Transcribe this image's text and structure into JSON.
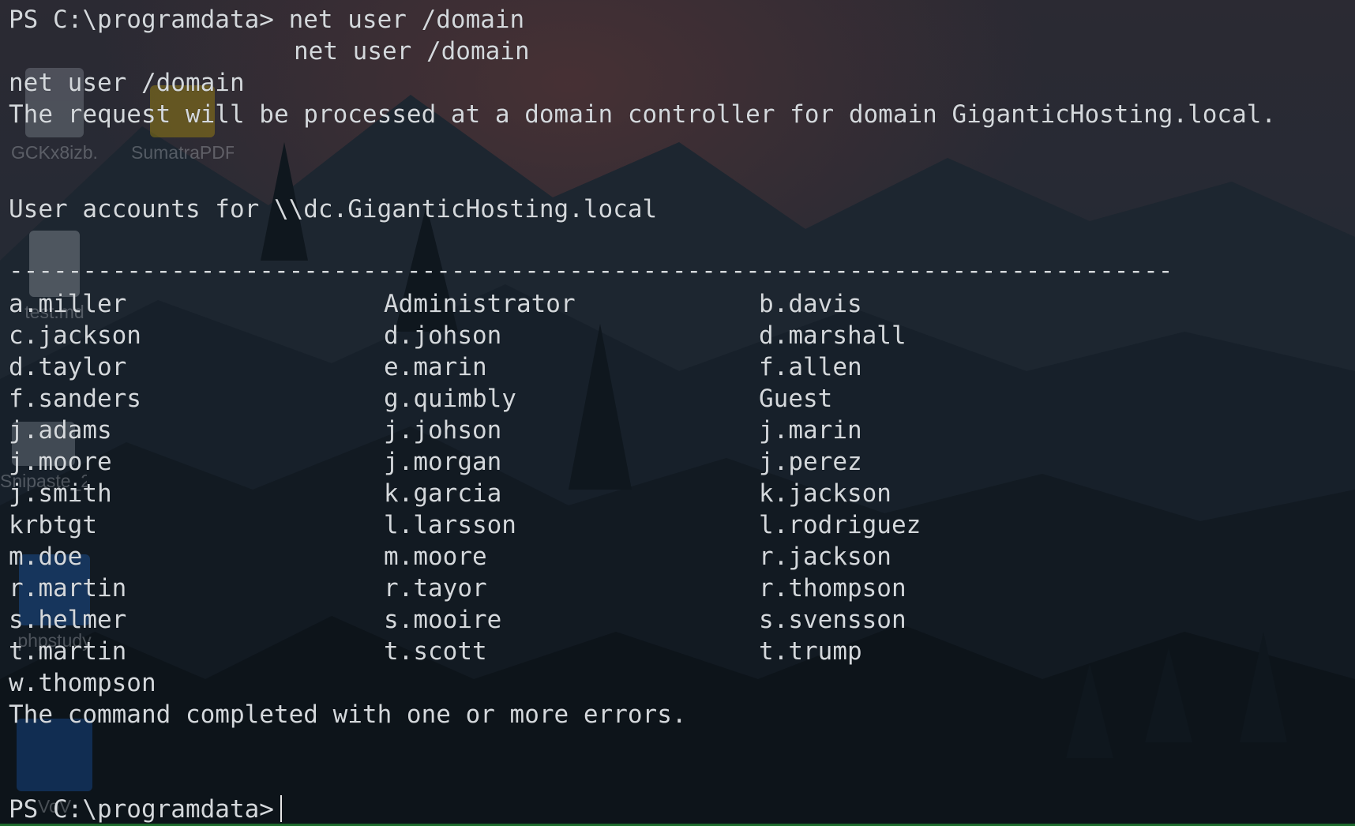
{
  "desktop": {
    "icons": [
      {
        "label": "GCKx8izb...",
        "icon": "image-file-icon"
      },
      {
        "label": "SumatraPDF",
        "icon": "pdf-reader-icon"
      },
      {
        "label": "test.md",
        "icon": "text-file-icon"
      },
      {
        "label": "Snipaste_2",
        "icon": "image-file-icon"
      },
      {
        "label": "phpstudy",
        "icon": "php-app-icon"
      },
      {
        "label": "VoV",
        "icon": "app-shortcut-icon"
      }
    ]
  },
  "terminal": {
    "cmd_line": "PS C:\\programdata> net user /domain",
    "echo_line": "net user /domain",
    "echo_line2": "net user /domain",
    "request_line": "The request will be processed at a domain controller for domain GiganticHosting.local.",
    "accounts_header": "User accounts for \\\\dc.GiganticHosting.local",
    "separator": "-------------------------------------------------------------------------------",
    "users": [
      [
        "a.miller",
        "Administrator",
        "b.davis"
      ],
      [
        "c.jackson",
        "d.johson",
        "d.marshall"
      ],
      [
        "d.taylor",
        "e.marin",
        "f.allen"
      ],
      [
        "f.sanders",
        "g.quimbly",
        "Guest"
      ],
      [
        "j.adams",
        "j.johson",
        "j.marin"
      ],
      [
        "j.moore",
        "j.morgan",
        "j.perez"
      ],
      [
        "j.smith",
        "k.garcia",
        "k.jackson"
      ],
      [
        "krbtgt",
        "l.larsson",
        "l.rodriguez"
      ],
      [
        "m.doe",
        "m.moore",
        "r.jackson"
      ],
      [
        "r.martin",
        "r.tayor",
        "r.thompson"
      ],
      [
        "s.helmer",
        "s.mooire",
        "s.svensson"
      ],
      [
        "t.martin",
        "t.scott",
        "t.trump"
      ],
      [
        "w.thompson",
        "",
        ""
      ]
    ],
    "completion_line": "The command completed with one or more errors.",
    "prompt": "PS C:\\programdata>"
  }
}
